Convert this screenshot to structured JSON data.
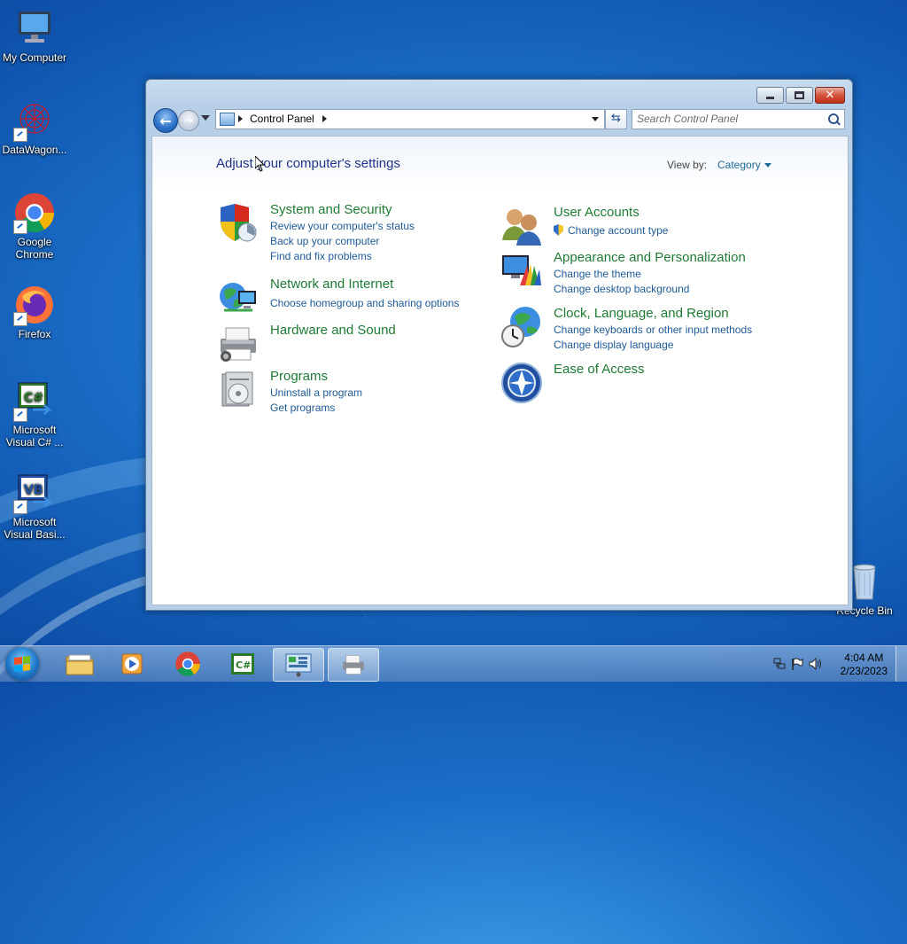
{
  "desktop": {
    "icons": [
      {
        "label": "My Computer"
      },
      {
        "label": "DataWagon..."
      },
      {
        "label": "Google Chrome"
      },
      {
        "label": "Firefox"
      },
      {
        "label": "Microsoft Visual C# ..."
      },
      {
        "label": "Microsoft Visual Basi..."
      },
      {
        "label": "Recycle Bin"
      }
    ]
  },
  "window": {
    "address": {
      "crumb": "Control Panel"
    },
    "search": {
      "placeholder": "Search Control Panel"
    },
    "page_title": "Adjust your computer's settings",
    "view_by_label": "View by:",
    "view_by_value": "Category",
    "categories": [
      {
        "title": "System and Security",
        "icon": "shield-icon",
        "links": [
          "Review your computer's status",
          "Back up your computer",
          "Find and fix problems"
        ]
      },
      {
        "title": "Network and Internet",
        "icon": "network-icon",
        "links": [
          "Choose homegroup and sharing options"
        ]
      },
      {
        "title": "Hardware and Sound",
        "icon": "printer-icon",
        "links": []
      },
      {
        "title": "Programs",
        "icon": "programs-icon",
        "links": [
          "Uninstall a program",
          "Get programs"
        ]
      },
      {
        "title": "User Accounts",
        "icon": "users-icon",
        "links": [
          "Change account type"
        ]
      },
      {
        "title": "Appearance and Personalization",
        "icon": "appearance-icon",
        "links": [
          "Change the theme",
          "Change desktop background"
        ]
      },
      {
        "title": "Clock, Language, and Region",
        "icon": "clock-globe-icon",
        "links": [
          "Change keyboards or other input methods",
          "Change display language"
        ]
      },
      {
        "title": "Ease of Access",
        "icon": "ease-of-access-icon",
        "links": []
      }
    ]
  },
  "taskbar": {
    "clock": {
      "time": "4:04 AM",
      "date": "2/23/2023"
    }
  }
}
